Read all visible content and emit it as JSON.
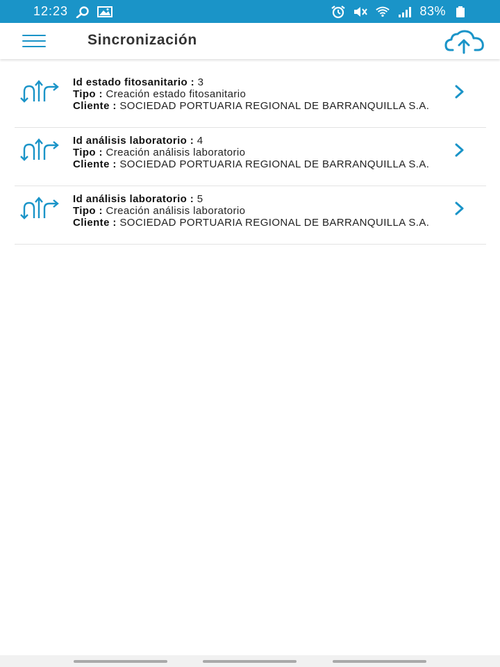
{
  "status_bar": {
    "time": "12:23",
    "battery": "83%"
  },
  "header": {
    "title": "Sincronización",
    "menu_icon": "hamburger-menu-icon",
    "upload_icon": "cloud-upload-icon"
  },
  "colors": {
    "accent": "#1a94c8",
    "status_bar": "#1a94c8",
    "divider": "#e3e3e3"
  },
  "items": [
    {
      "id_label": "Id estado fitosanitario :",
      "id_value": "3",
      "tipo_label": "Tipo :",
      "tipo_value": "Creación estado fitosanitario",
      "cliente_label": "Cliente :",
      "cliente_value": "SOCIEDAD PORTUARIA REGIONAL DE BARRANQUILLA S.A."
    },
    {
      "id_label": "Id análisis laboratorio :",
      "id_value": "4",
      "tipo_label": "Tipo :",
      "tipo_value": "Creación análisis laboratorio",
      "cliente_label": "Cliente :",
      "cliente_value": "SOCIEDAD PORTUARIA REGIONAL DE BARRANQUILLA S.A."
    },
    {
      "id_label": "Id análisis laboratorio :",
      "id_value": "5",
      "tipo_label": "Tipo :",
      "tipo_value": "Creación análisis laboratorio",
      "cliente_label": "Cliente :",
      "cliente_value": "SOCIEDAD PORTUARIA REGIONAL DE BARRANQUILLA S.A."
    }
  ]
}
